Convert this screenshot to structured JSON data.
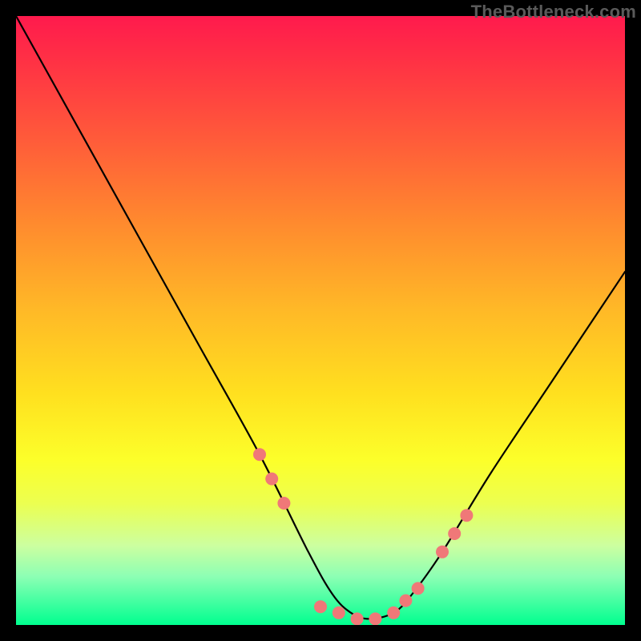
{
  "watermark": "TheBottleneck.com",
  "chart_data": {
    "type": "line",
    "title": "",
    "xlabel": "",
    "ylabel": "",
    "xlim": [
      0,
      100
    ],
    "ylim": [
      0,
      100
    ],
    "grid": false,
    "legend": false,
    "annotations": [],
    "series": [
      {
        "name": "bottleneck-curve",
        "x": [
          0,
          10,
          20,
          30,
          40,
          48,
          52,
          55,
          58,
          62,
          65,
          70,
          78,
          88,
          100
        ],
        "values": [
          100,
          82,
          64,
          46,
          28,
          12,
          5,
          2,
          1,
          2,
          5,
          12,
          25,
          40,
          58
        ]
      }
    ],
    "markers": {
      "name": "highlight-dots",
      "color": "#f07878",
      "x": [
        40,
        42,
        44,
        50,
        53,
        56,
        59,
        62,
        64,
        66,
        70,
        72,
        74
      ],
      "values": [
        28,
        24,
        20,
        3,
        2,
        1,
        1,
        2,
        4,
        6,
        12,
        15,
        18
      ]
    },
    "background": {
      "type": "vertical-gradient",
      "stops": [
        {
          "pos": 0,
          "color": "#ff1a4d"
        },
        {
          "pos": 20,
          "color": "#ff5a3a"
        },
        {
          "pos": 48,
          "color": "#ffb827"
        },
        {
          "pos": 73,
          "color": "#fcff2a"
        },
        {
          "pos": 92,
          "color": "#8dffb4"
        },
        {
          "pos": 100,
          "color": "#00ff8f"
        }
      ]
    }
  }
}
